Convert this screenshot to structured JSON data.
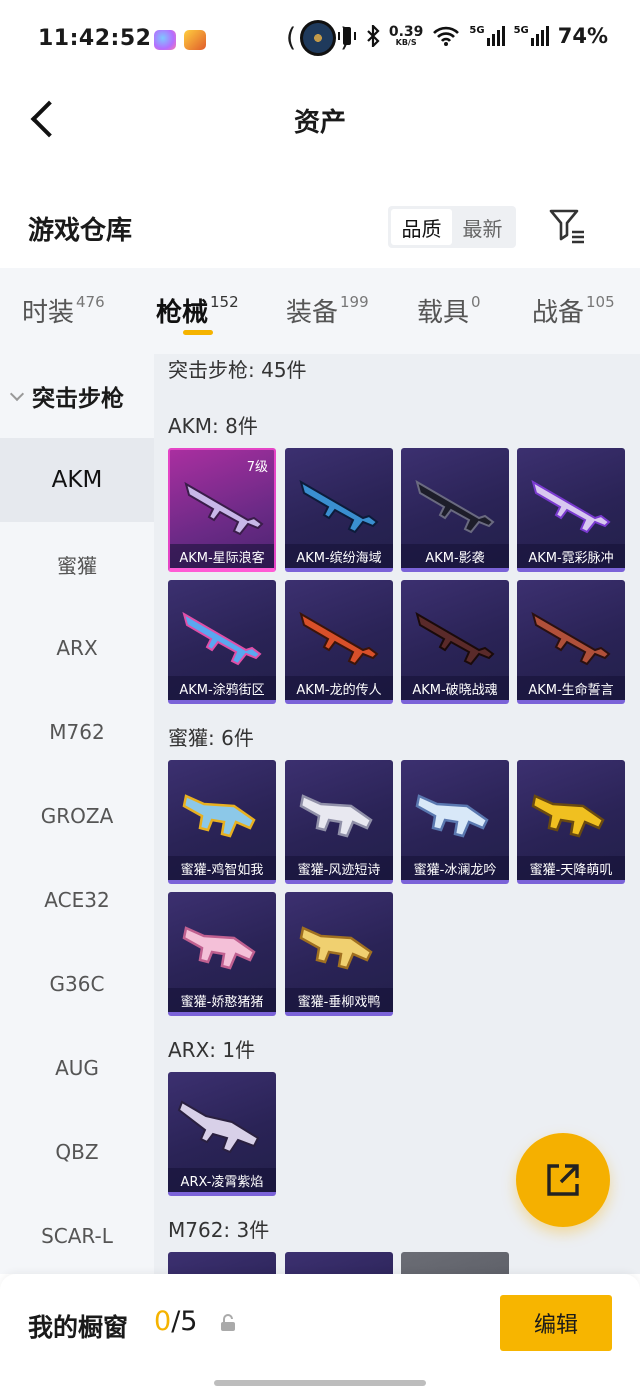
{
  "status_bar": {
    "time": "11:42:52",
    "net_speed": "0.39",
    "net_unit": "KB/S",
    "battery": "74%",
    "network_1": "5G",
    "network_2": "5G"
  },
  "header": {
    "title": "资产"
  },
  "warehouse": {
    "title": "游戏仓库",
    "sort_options": [
      "品质",
      "最新"
    ],
    "sort_selected": "品质"
  },
  "tabs": [
    {
      "label": "时装",
      "count": "476"
    },
    {
      "label": "枪械",
      "count": "152"
    },
    {
      "label": "装备",
      "count": "199"
    },
    {
      "label": "载具",
      "count": "0"
    },
    {
      "label": "战备",
      "count": "105"
    }
  ],
  "active_tab": "枪械",
  "sidebar": {
    "group": "突击步枪",
    "items": [
      "AKM",
      "蜜獾",
      "ARX",
      "M762",
      "GROZA",
      "ACE32",
      "G36C",
      "AUG",
      "QBZ",
      "SCAR-L"
    ],
    "selected": "AKM"
  },
  "content": {
    "category_header": "突击步枪: 45件",
    "sections": [
      {
        "header": "AKM: 8件",
        "items": [
          {
            "name": "AKM-星际浪客",
            "level": "7级",
            "rarity": "pink"
          },
          {
            "name": "AKM-缤纷海域"
          },
          {
            "name": "AKM-影袭"
          },
          {
            "name": "AKM-霓彩脉冲"
          },
          {
            "name": "AKM-涂鸦街区"
          },
          {
            "name": "AKM-龙的传人"
          },
          {
            "name": "AKM-破晓战魂"
          },
          {
            "name": "AKM-生命誓言"
          }
        ]
      },
      {
        "header": "蜜獾: 6件",
        "items": [
          {
            "name": "蜜獾-鸡智如我"
          },
          {
            "name": "蜜獾-风迹短诗"
          },
          {
            "name": "蜜獾-冰澜龙吟"
          },
          {
            "name": "蜜獾-天降萌叽"
          },
          {
            "name": "蜜獾-娇憨猪猪"
          },
          {
            "name": "蜜獾-垂柳戏鸭"
          }
        ]
      },
      {
        "header": "ARX: 1件",
        "items": [
          {
            "name": "ARX-凌霄紫焰"
          }
        ]
      },
      {
        "header": "M762: 3件",
        "items": []
      }
    ]
  },
  "bottom_bar": {
    "label": "我的橱窗",
    "current": "0",
    "separator": "/",
    "max": "5",
    "edit_label": "编辑"
  },
  "colors": {
    "accent": "#f5b300",
    "card_bg": "#2a2356",
    "card_rare": "#a92fa0"
  }
}
